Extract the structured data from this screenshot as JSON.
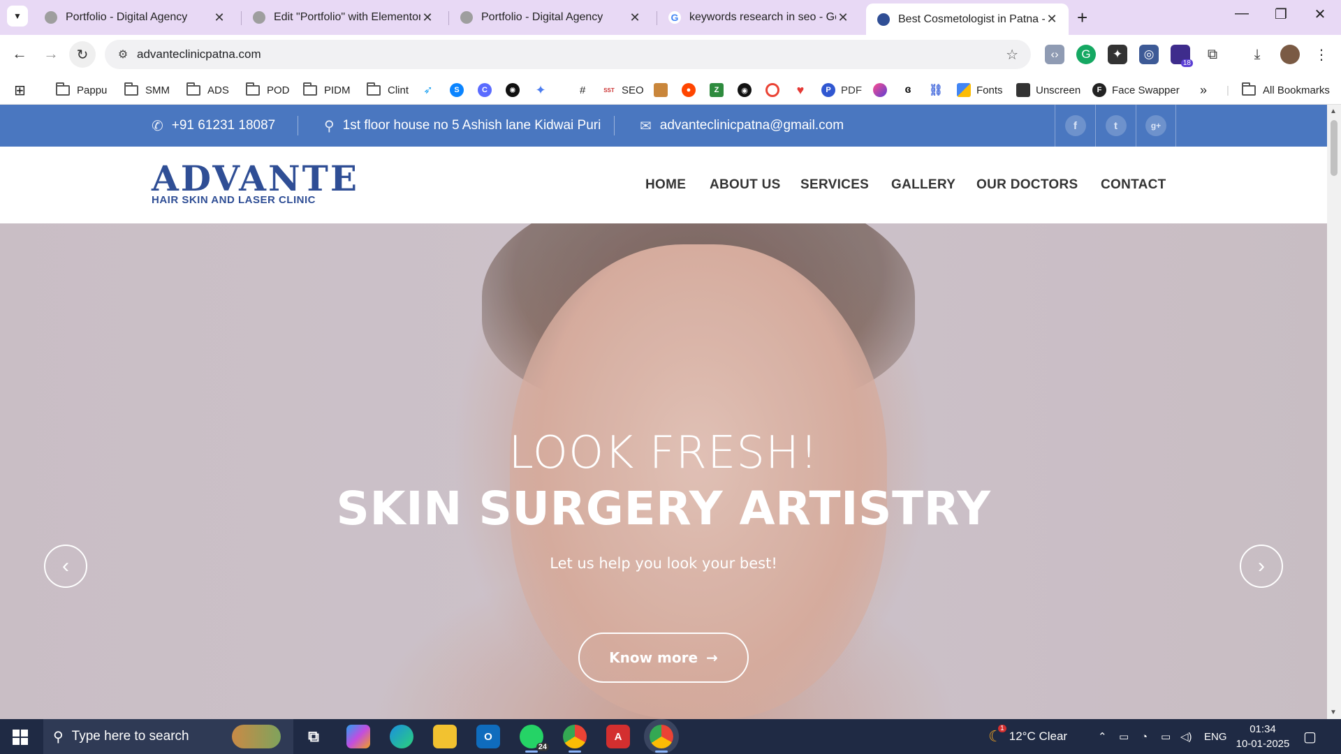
{
  "browser": {
    "tabs": [
      {
        "title": "Portfolio - Digital Agency",
        "active": false
      },
      {
        "title": "Edit \"Portfolio\" with Elementor",
        "active": false
      },
      {
        "title": "Portfolio - Digital Agency",
        "active": false
      },
      {
        "title": "keywords research in seo - Goo",
        "active": false
      },
      {
        "title": "Best Cosmetologist in Patna - A",
        "active": true
      }
    ],
    "url": "advanteclinicpatna.com",
    "bookmarks": [
      "Pappu",
      "SMM",
      "ADS",
      "POD",
      "PIDM",
      "Clint",
      "#",
      "SEO",
      "PDF",
      "Fonts",
      "Unscreen",
      "Face Swapper"
    ],
    "all_bookmarks": "All Bookmarks",
    "extension_badge": "18"
  },
  "site": {
    "topbar": {
      "phone": "+91 61231 18087",
      "address": "1st floor house no 5 Ashish lane Kidwai Puri",
      "email": "advanteclinicpatna@gmail.com",
      "social": [
        "f",
        "t",
        "g+"
      ]
    },
    "logo": {
      "brand": "ADVANTE",
      "tagline": "HAIR SKIN AND LASER CLINIC"
    },
    "nav": [
      "HOME",
      "ABOUT US",
      "SERVICES",
      "GALLERY",
      "OUR DOCTORS",
      "CONTACT"
    ],
    "hero": {
      "headline_1": "LOOK FRESH!",
      "headline_2": "SKIN SURGERY ARTISTRY",
      "subtitle": "Let us help you look your best!",
      "cta": "Know more",
      "cta_arrow": "→",
      "prev": "‹",
      "next": "›"
    }
  },
  "taskbar": {
    "search_placeholder": "Type here to search",
    "whatsapp_badge": "24",
    "weather": "12°C  Clear",
    "weather_badge": "1",
    "language": "ENG",
    "time": "01:34",
    "date": "10-01-2025"
  },
  "colors": {
    "topbar": "#4a77c0",
    "logo": "#2f4e95",
    "tab_strip": "#e8d9f5",
    "taskbar": "#1f2a44"
  }
}
